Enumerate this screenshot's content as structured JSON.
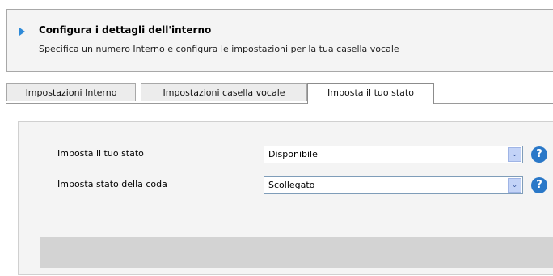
{
  "header": {
    "title": "Configura i dettagli dell'interno",
    "subtitle": "Specifica un numero Interno e configura le impostazioni per la tua casella vocale"
  },
  "tabs": [
    {
      "label": "Impostazioni Interno",
      "active": false
    },
    {
      "label": "Impostazioni casella vocale",
      "active": false
    },
    {
      "label": "Imposta il tuo stato",
      "active": true
    }
  ],
  "form": {
    "status_label": "Imposta il tuo stato",
    "status_value": "Disponibile",
    "queue_label": "Imposta stato della coda",
    "queue_value": "Scollegato",
    "help_glyph": "?",
    "chevron_glyph": "⌄"
  },
  "colors": {
    "accent": "#2a78c8",
    "arrow": "#2e8ad8"
  }
}
